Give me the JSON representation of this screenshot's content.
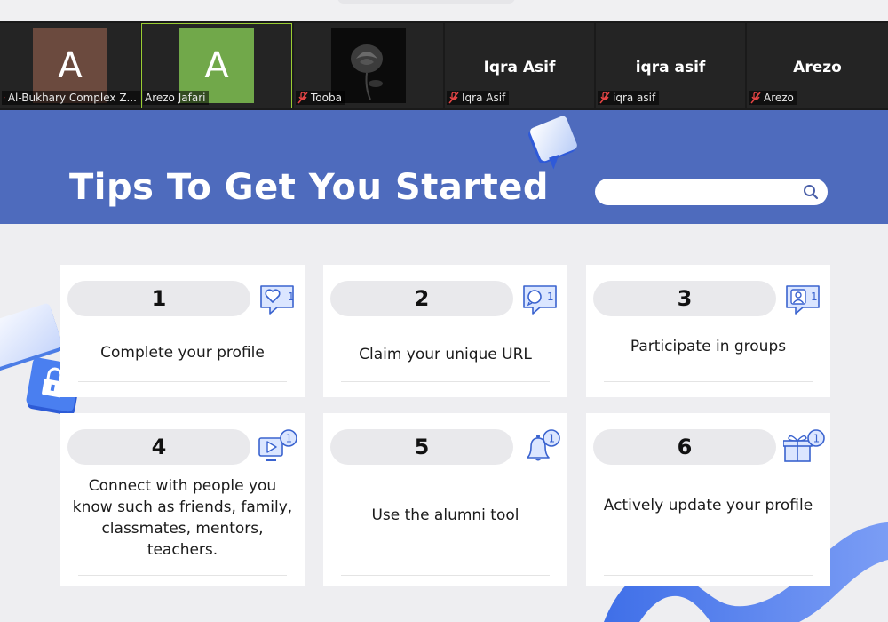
{
  "participants": [
    {
      "display": "A",
      "label": "Al-Bukhary Complex Z...",
      "muted": true
    },
    {
      "display": "A",
      "label": "Arezo Jafari",
      "muted": false
    },
    {
      "display": "",
      "label": "Tooba",
      "muted": true
    },
    {
      "display": "Iqra Asif",
      "label": "Iqra Asif",
      "muted": true
    },
    {
      "display": "iqra asif",
      "label": "iqra asif",
      "muted": true
    },
    {
      "display": "Arezo",
      "label": "Arezo",
      "muted": true
    }
  ],
  "banner": {
    "title": "Tips To Get You Started",
    "search_placeholder": ""
  },
  "tips": [
    {
      "number": "1",
      "text": "Complete your profile",
      "icon": "heart-notification-icon",
      "badge": "1"
    },
    {
      "number": "2",
      "text": "Claim your unique URL",
      "icon": "comment-notification-icon",
      "badge": "1"
    },
    {
      "number": "3",
      "text": "Participate in groups",
      "icon": "user-notification-icon",
      "badge": "1"
    },
    {
      "number": "4",
      "text": "Connect with people you know such as friends, family, classmates, mentors, teachers.",
      "icon": "video-notification-icon",
      "badge": "1"
    },
    {
      "number": "5",
      "text": "Use the alumni tool",
      "icon": "bell-notification-icon",
      "badge": "1"
    },
    {
      "number": "6",
      "text": "Actively update your profile",
      "icon": "gift-notification-icon",
      "badge": "1"
    }
  ],
  "colors": {
    "banner": "#4e6bbd",
    "accent": "#4a6fd8",
    "background": "#eeeef1",
    "gallery": "#1a1a1a"
  }
}
